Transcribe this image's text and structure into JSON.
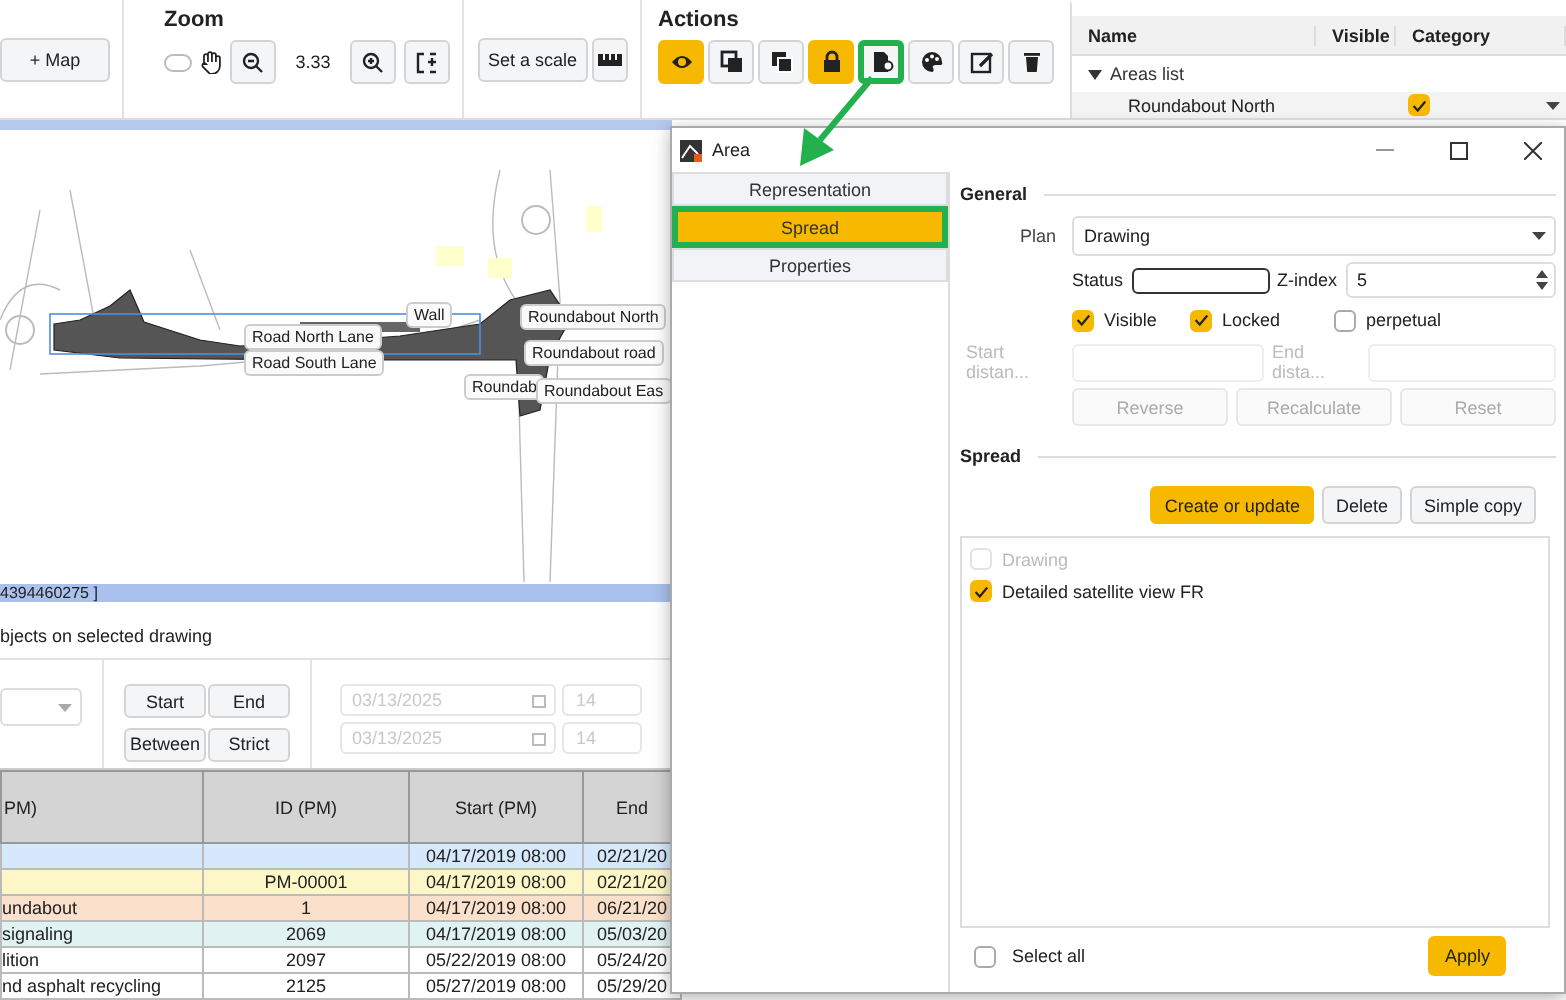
{
  "toolbar": {
    "map_button": {
      "icon": "+",
      "label": "Map"
    },
    "zoom": {
      "title": "Zoom",
      "value": "3.33",
      "pan_mode": false
    },
    "scale_button": "Set a scale",
    "actions": {
      "title": "Actions",
      "buttons": [
        {
          "kind": "eye",
          "active": true,
          "highlighted": false
        },
        {
          "kind": "front",
          "active": false,
          "highlighted": false
        },
        {
          "kind": "back",
          "active": false,
          "highlighted": false
        },
        {
          "kind": "lock",
          "active": true,
          "highlighted": false
        },
        {
          "kind": "spread",
          "active": false,
          "highlighted": true
        },
        {
          "kind": "palette",
          "active": false,
          "highlighted": false
        },
        {
          "kind": "edit",
          "active": false,
          "highlighted": false
        },
        {
          "kind": "trash",
          "active": false,
          "highlighted": false
        }
      ]
    }
  },
  "areas_panel": {
    "columns": [
      "Name",
      "Visible",
      "Category"
    ],
    "group": {
      "label": "Areas list",
      "expanded": true
    },
    "rows": [
      {
        "name": "Roundabout North",
        "visible": true
      }
    ]
  },
  "map": {
    "labels": [
      {
        "text": "Wall"
      },
      {
        "text": "Roundabout North"
      },
      {
        "text": "Road North Lane"
      },
      {
        "text": "Road South Lane"
      },
      {
        "text": "Roundabout road"
      },
      {
        "text": "Roundab"
      },
      {
        "text": "Roundabout Eas"
      }
    ],
    "coordinates": "4394460275 ]"
  },
  "objects_panel": {
    "title": "bjects on selected drawing",
    "mode_buttons": [
      {
        "label": "Start",
        "selected": false
      },
      {
        "label": "End",
        "selected": false
      },
      {
        "label": "Between",
        "selected": false
      },
      {
        "label": "Strict",
        "selected": false
      }
    ],
    "date_fields": [
      {
        "date": "03/13/2025",
        "hour": "14"
      },
      {
        "date": "03/13/2025",
        "hour": "14"
      }
    ],
    "table": {
      "columns": [
        "PM)",
        "ID (PM)",
        "Start (PM)",
        "End"
      ],
      "rows": [
        {
          "color": "#d6e8fb",
          "cells": [
            "",
            "",
            "04/17/2019 08:00",
            "02/21/20"
          ]
        },
        {
          "color": "#fdf7c8",
          "cells": [
            "",
            "PM-00001",
            "04/17/2019 08:00",
            "02/21/20"
          ]
        },
        {
          "color": "#fbe0cb",
          "cells": [
            "undabout",
            "1",
            "04/17/2019 08:00",
            "06/21/20"
          ]
        },
        {
          "color": "#e0f2f1",
          "cells": [
            "signaling",
            "2069",
            "04/17/2019 08:00",
            "05/03/20"
          ]
        },
        {
          "color": "#ffffff",
          "cells": [
            "lition",
            "2097",
            "05/22/2019 08:00",
            "05/24/20"
          ]
        },
        {
          "color": "#ffffff",
          "cells": [
            "nd asphalt recycling",
            "2125",
            "05/27/2019 08:00",
            "05/29/20"
          ]
        }
      ]
    }
  },
  "dialog": {
    "title": "Area",
    "nav": [
      {
        "label": "Representation",
        "selected": false,
        "highlighted": false
      },
      {
        "label": "Spread",
        "selected": true,
        "highlighted": true
      },
      {
        "label": "Properties",
        "selected": false,
        "highlighted": false
      }
    ],
    "general": {
      "title": "General",
      "plan_label": "Plan",
      "plan_value": "Drawing",
      "status_label": "Status",
      "zindex_label": "Z-index",
      "zindex_value": "5",
      "checks": [
        {
          "label": "Visible",
          "checked": true
        },
        {
          "label": "Locked",
          "checked": true
        },
        {
          "label": "perpetual",
          "checked": false
        }
      ],
      "start_label": "Start distan...",
      "end_label": "End dista...",
      "buttons": [
        {
          "label": "Reverse",
          "disabled": true
        },
        {
          "label": "Recalculate",
          "disabled": true
        },
        {
          "label": "Reset",
          "disabled": true
        }
      ]
    },
    "spread": {
      "title": "Spread",
      "buttons": [
        {
          "label": "Create or update",
          "primary": true
        },
        {
          "label": "Delete",
          "primary": false
        },
        {
          "label": "Simple copy",
          "primary": false
        }
      ],
      "items": [
        {
          "label": "Drawing",
          "checked": false,
          "disabled": true
        },
        {
          "label": "Detailed satellite view FR",
          "checked": true,
          "disabled": false
        }
      ],
      "select_all": {
        "label": "Select all",
        "checked": false
      },
      "apply": "Apply"
    }
  }
}
